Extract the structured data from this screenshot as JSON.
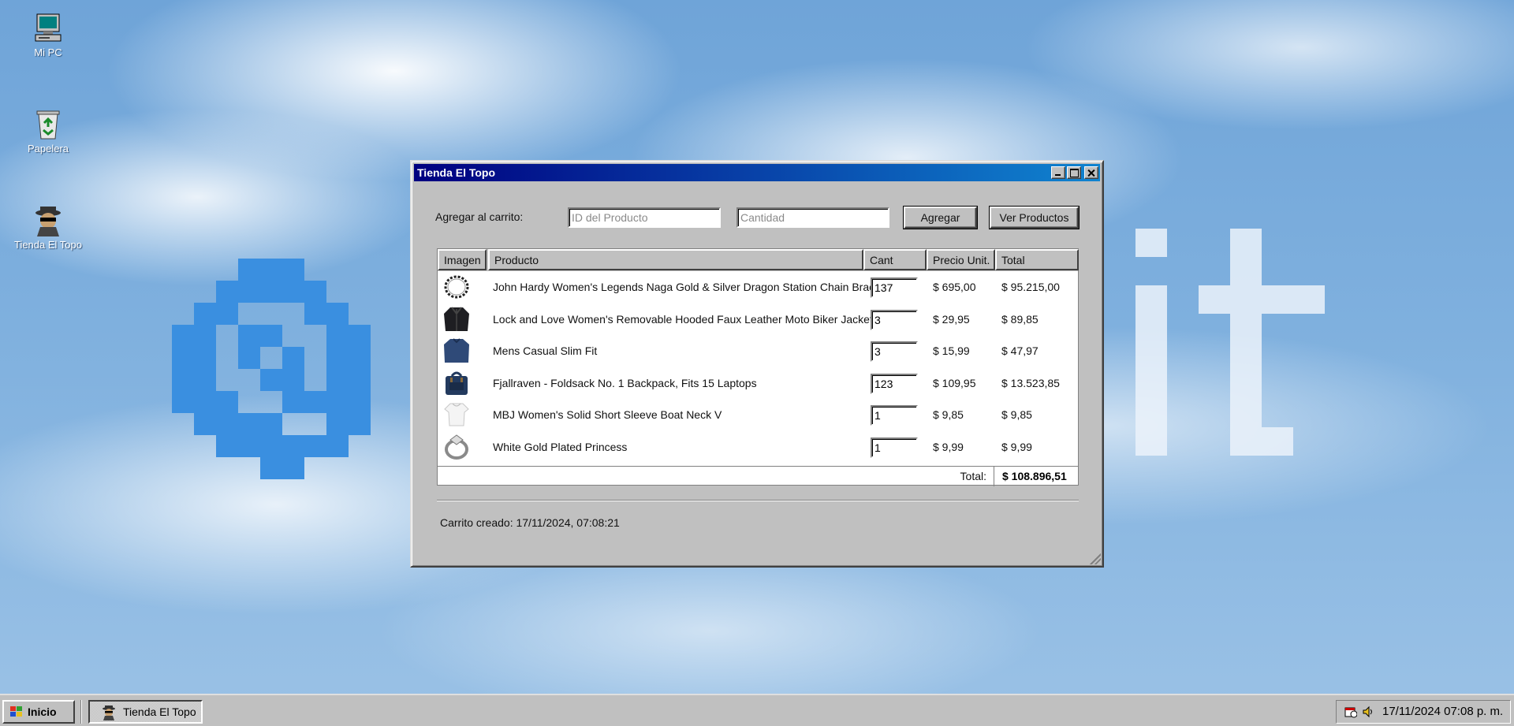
{
  "desktop": {
    "icons": [
      {
        "label": "Mi PC",
        "icon": "computer-icon"
      },
      {
        "label": "Papelera",
        "icon": "recycle-bin-icon"
      },
      {
        "label": "Tienda El Topo",
        "icon": "spy-mole-icon"
      }
    ]
  },
  "window": {
    "title": "Tienda El Topo",
    "add_label": "Agregar al carrito:",
    "product_id_placeholder": "ID del Producto",
    "quantity_placeholder": "Cantidad",
    "add_button": "Agregar",
    "view_products_button": "Ver Productos",
    "table": {
      "headers": {
        "image": "Imagen",
        "product": "Producto",
        "qty": "Cant",
        "unit_price": "Precio Unit.",
        "total": "Total"
      },
      "rows": [
        {
          "product": "John Hardy Women's Legends Naga Gold & Silver Dragon Station Chain Bracelet",
          "qty": "137",
          "unit_price": "$ 695,00",
          "total": "$ 95.215,00",
          "image": "bracelet-icon"
        },
        {
          "product": "Lock and Love Women's Removable Hooded Faux Leather Moto Biker Jacket",
          "qty": "3",
          "unit_price": "$ 29,95",
          "total": "$ 89,85",
          "image": "jacket-icon"
        },
        {
          "product": "Mens Casual Slim Fit",
          "qty": "3",
          "unit_price": "$ 15,99",
          "total": "$ 47,97",
          "image": "shirt-icon"
        },
        {
          "product": "Fjallraven - Foldsack No. 1 Backpack, Fits 15 Laptops",
          "qty": "123",
          "unit_price": "$ 109,95",
          "total": "$ 13.523,85",
          "image": "backpack-icon"
        },
        {
          "product": "MBJ Women's Solid Short Sleeve Boat Neck V",
          "qty": "1",
          "unit_price": "$ 9,85",
          "total": "$ 9,85",
          "image": "tshirt-icon"
        },
        {
          "product": "White Gold Plated Princess",
          "qty": "1",
          "unit_price": "$ 9,99",
          "total": "$ 9,99",
          "image": "ring-icon"
        }
      ],
      "total_label": "Total:",
      "total_value": "$ 108.896,51"
    },
    "created": "Carrito creado: 17/11/2024, 07:08:21"
  },
  "taskbar": {
    "start_label": "Inicio",
    "task_label": "Tienda El Topo",
    "clock": "17/11/2024 07:08 p. m."
  },
  "colors": {
    "titlebar_start": "#000080",
    "titlebar_end": "#1084d0",
    "face": "#c0c0c0",
    "desktop": "#7fb0de"
  }
}
